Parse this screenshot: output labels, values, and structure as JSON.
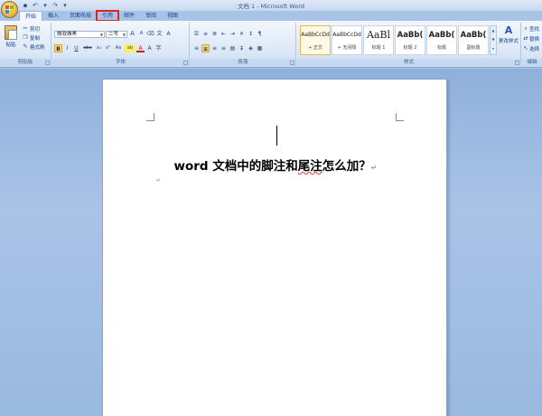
{
  "window": {
    "title": "文档 1 - Microsoft Word"
  },
  "quick_access": [
    {
      "name": "save-icon",
      "glyph": "▪"
    },
    {
      "name": "undo-icon",
      "glyph": "↶"
    },
    {
      "name": "undo-dropdown-icon",
      "glyph": "▾"
    },
    {
      "name": "redo-icon",
      "glyph": "↷"
    },
    {
      "name": "customize-icon",
      "glyph": "▾"
    }
  ],
  "tabs": [
    {
      "label": "开始",
      "active": true
    },
    {
      "label": "插入"
    },
    {
      "label": "页面布局"
    },
    {
      "label": "引用",
      "highlight": true,
      "highlight_color": "#e2231a"
    },
    {
      "label": "邮件"
    },
    {
      "label": "审阅"
    },
    {
      "label": "视图"
    }
  ],
  "clipboard": {
    "paste": "粘贴",
    "cut": "剪切",
    "copy": "复制",
    "format_painter": "格式刷",
    "label": "剪贴板"
  },
  "font": {
    "name": "微软雅黑",
    "size": "二号",
    "grow_glyph": "A",
    "shrink_glyph": "A",
    "clear_glyph": "⌫",
    "bold": "B",
    "italic": "I",
    "underline": "U",
    "strike": "abe",
    "sub": "x₂",
    "sup": "x²",
    "case": "Aa",
    "highlight_glyph": "ab",
    "color_glyph": "A",
    "label": "字体"
  },
  "paragraph": {
    "label": "段落"
  },
  "styles": {
    "label": "样式",
    "items": [
      {
        "sample": "AaBbCcDd",
        "name": "+ 正文",
        "selected": true
      },
      {
        "sample": "AaBbCcDd",
        "name": "+ 无间隔"
      },
      {
        "sample": "AaBl",
        "name": "标题 1"
      },
      {
        "sample": "AaBb(",
        "name": "标题 2"
      },
      {
        "sample": "AaBb(",
        "name": "标题"
      },
      {
        "sample": "AaBb(",
        "name": "副标题"
      }
    ],
    "change_styles": "更改样式"
  },
  "editing": {
    "label": "编辑",
    "find": "查找",
    "replace": "替换",
    "select": "选择"
  },
  "document": {
    "heading_before": "word 文档中的脚注和",
    "heading_squiggle": "尾注",
    "heading_after": "怎么加？",
    "para_mark": "↵",
    "small_mark": "↵"
  },
  "colors": {
    "accent_red": "#e2231a",
    "ribbon_bg": "#dbe7f6",
    "workspace_bg": "#a9c3e6"
  }
}
